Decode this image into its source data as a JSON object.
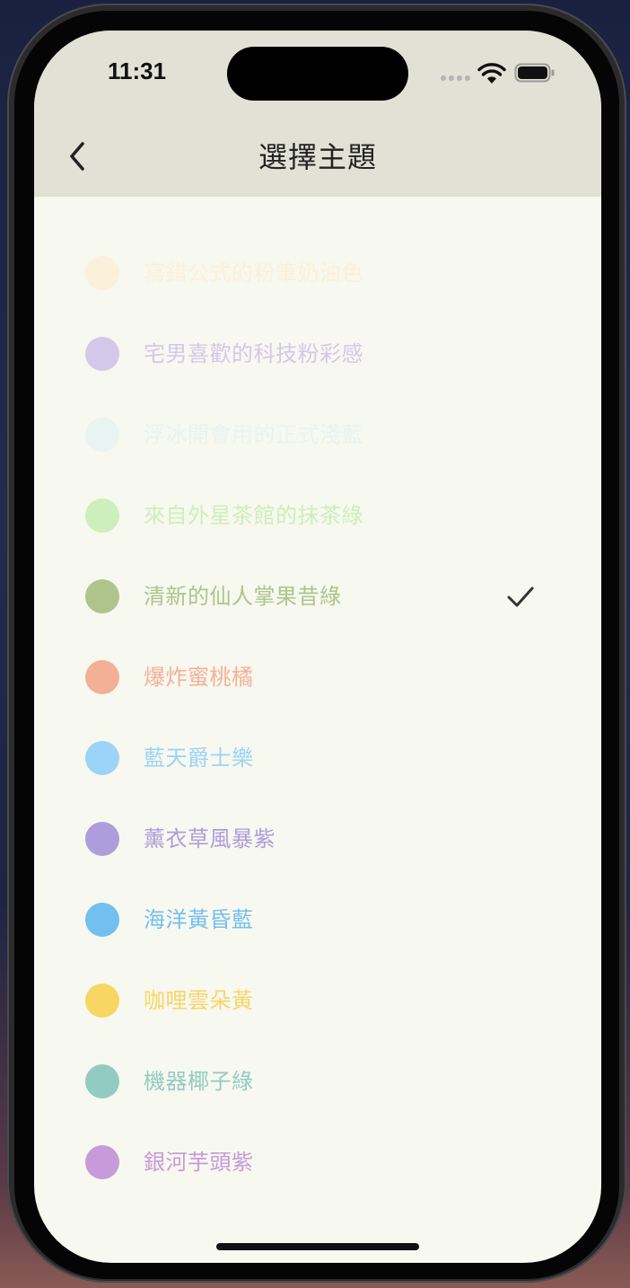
{
  "status_bar": {
    "time": "11:31"
  },
  "nav": {
    "title": "選擇主題",
    "back_icon": "chevron-left-icon"
  },
  "themes": [
    {
      "label": "寫錯公式的粉筆奶油色",
      "color": "#fbf0d9",
      "selected": false
    },
    {
      "label": "宅男喜歡的科技粉彩感",
      "color": "#d3c8ea",
      "selected": false
    },
    {
      "label": "浮冰開會用的正式淺藍",
      "color": "#e9f3f2",
      "selected": false
    },
    {
      "label": "來自外星茶館的抹茶綠",
      "color": "#cdefbb",
      "selected": false
    },
    {
      "label": "清新的仙人掌果昔綠",
      "color": "#aec48c",
      "selected": true
    },
    {
      "label": "爆炸蜜桃橘",
      "color": "#f4b097",
      "selected": false
    },
    {
      "label": "藍天爵士樂",
      "color": "#9bd4f6",
      "selected": false
    },
    {
      "label": "薰衣草風暴紫",
      "color": "#ae9ddc",
      "selected": false
    },
    {
      "label": "海洋黃昏藍",
      "color": "#72c0f0",
      "selected": false
    },
    {
      "label": "咖哩雲朵黃",
      "color": "#f7d664",
      "selected": false
    },
    {
      "label": "機器椰子綠",
      "color": "#93cbc3",
      "selected": false
    },
    {
      "label": "銀河芋頭紫",
      "color": "#c79bd9",
      "selected": false
    }
  ],
  "colors": {
    "header_bg": "#e1e2d5",
    "screen_bg": "#f7f8ef",
    "check": "#333333"
  }
}
